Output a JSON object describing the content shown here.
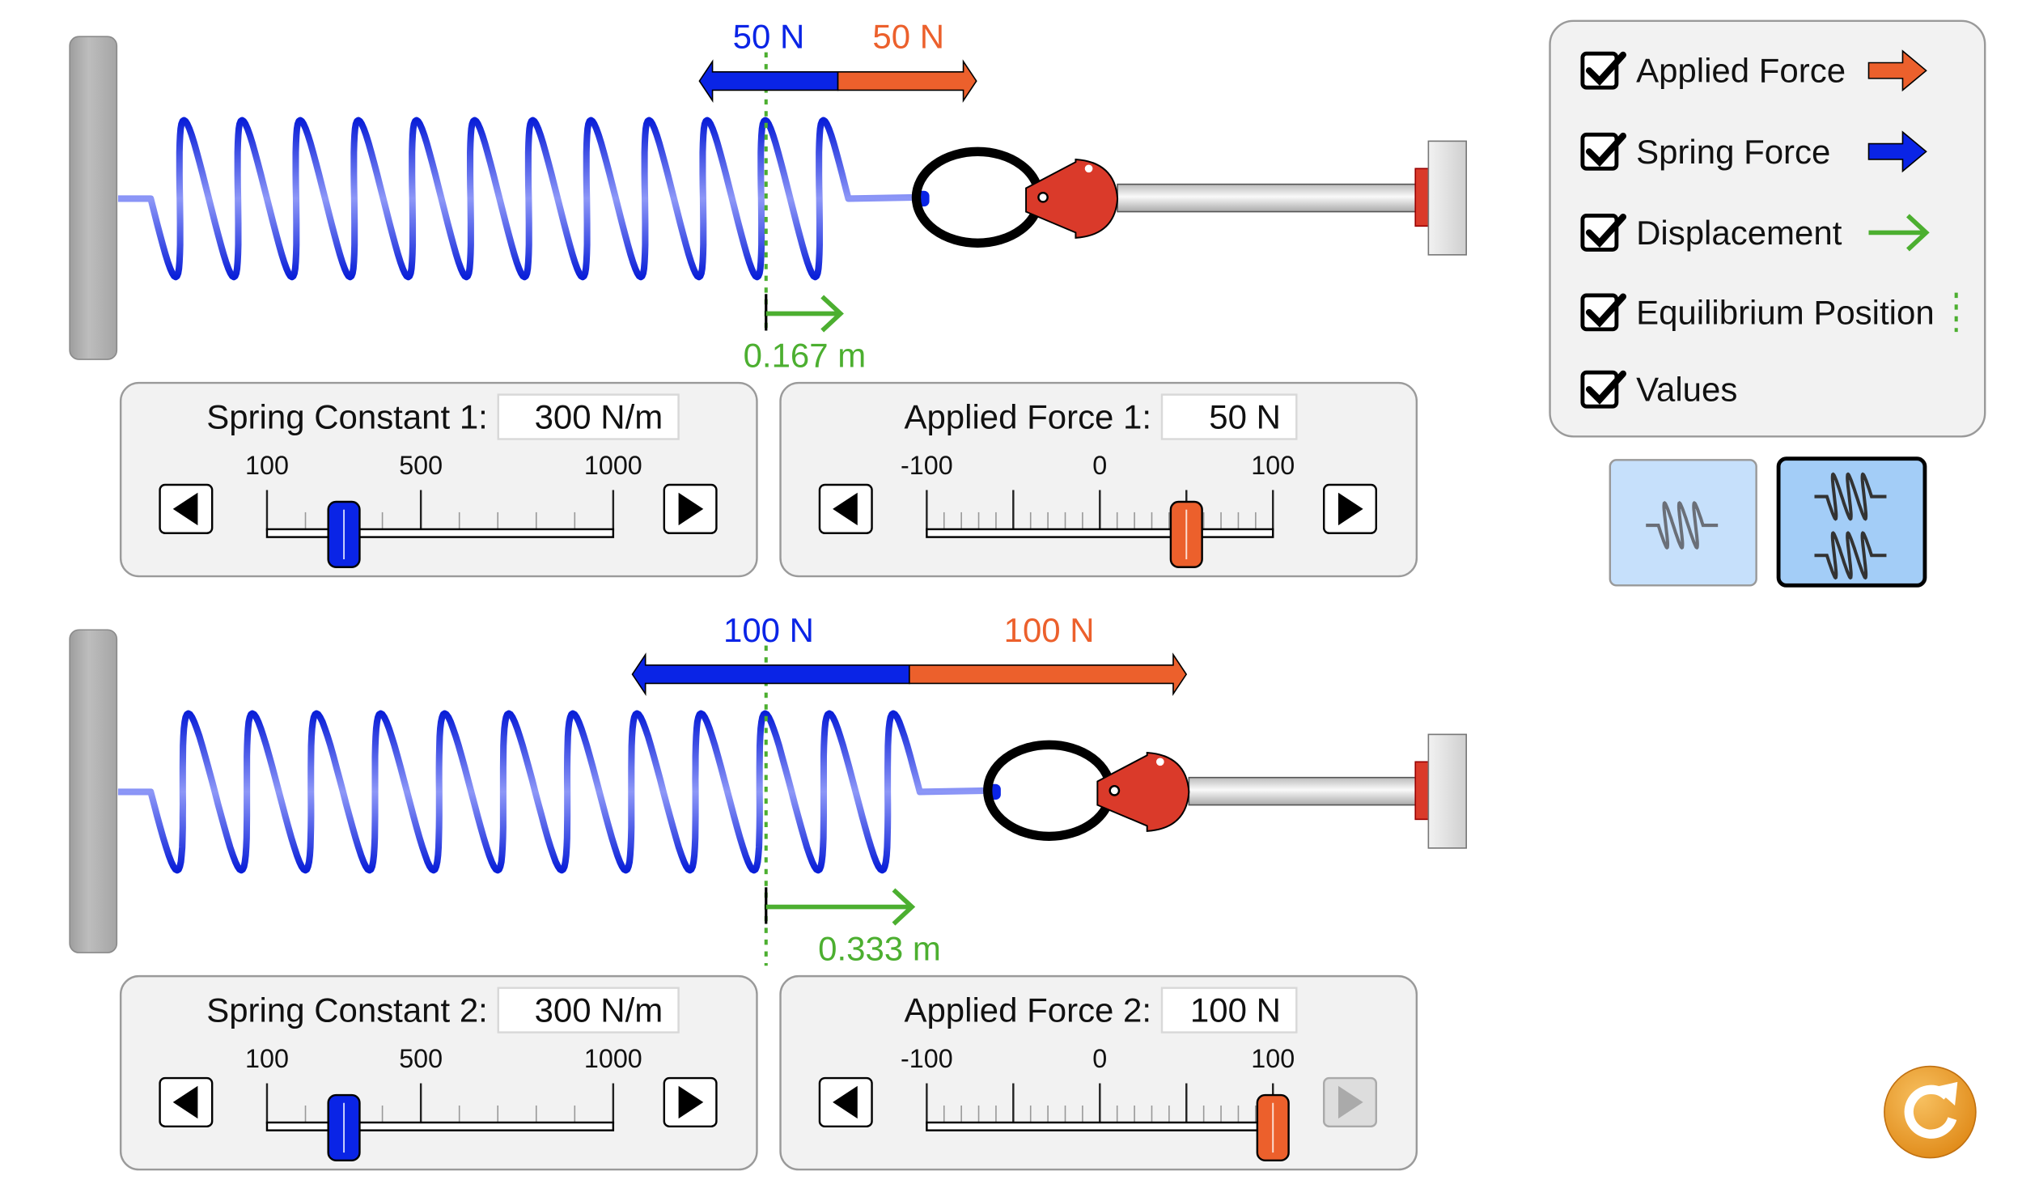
{
  "colors": {
    "spring_force": "#0a24e6",
    "applied_force": "#ec602c",
    "displacement": "#4caf30",
    "equilibrium": "#4caf30",
    "panel_bg": "#f2f2f2",
    "mode_button": "#c6e0fb",
    "mode_button_selected": "#a3cdf7",
    "reset": "#f0a030"
  },
  "systems": [
    {
      "spring_force_label": "50 N",
      "applied_force_label": "50 N",
      "spring_force_value": 50,
      "applied_force_value": 50,
      "displacement_label": "0.167 m",
      "displacement_value": 0.167,
      "spring_constant": {
        "label": "Spring Constant 1:",
        "value_text": "300 N/m",
        "value": 300,
        "min": 100,
        "max": 1000,
        "tick_labels": [
          "100",
          "500",
          "1000"
        ]
      },
      "applied_force": {
        "label": "Applied Force 1:",
        "value_text": "50 N",
        "value": 50,
        "min": -100,
        "max": 100,
        "tick_labels": [
          "-100",
          "0",
          "100"
        ],
        "increment_enabled": true
      }
    },
    {
      "spring_force_label": "100 N",
      "applied_force_label": "100 N",
      "spring_force_value": 100,
      "applied_force_value": 100,
      "displacement_label": "0.333 m",
      "displacement_value": 0.333,
      "spring_constant": {
        "label": "Spring Constant 2:",
        "value_text": "300 N/m",
        "value": 300,
        "min": 100,
        "max": 1000,
        "tick_labels": [
          "100",
          "500",
          "1000"
        ]
      },
      "applied_force": {
        "label": "Applied Force 2:",
        "value_text": "100 N",
        "value": 100,
        "min": -100,
        "max": 100,
        "tick_labels": [
          "-100",
          "0",
          "100"
        ],
        "increment_enabled": false
      }
    }
  ],
  "legend": {
    "items": [
      {
        "label": "Applied Force",
        "checked": true,
        "icon": "orange-arrow-icon"
      },
      {
        "label": "Spring Force",
        "checked": true,
        "icon": "blue-arrow-icon"
      },
      {
        "label": "Displacement",
        "checked": true,
        "icon": "green-arrow-icon"
      },
      {
        "label": "Equilibrium Position",
        "checked": true,
        "icon": "dotted-line-icon"
      },
      {
        "label": "Values",
        "checked": true,
        "icon": ""
      }
    ]
  },
  "mode_buttons": [
    {
      "name": "one-spring",
      "selected": false
    },
    {
      "name": "two-springs",
      "selected": true
    }
  ],
  "reset_icon": "reset-icon"
}
